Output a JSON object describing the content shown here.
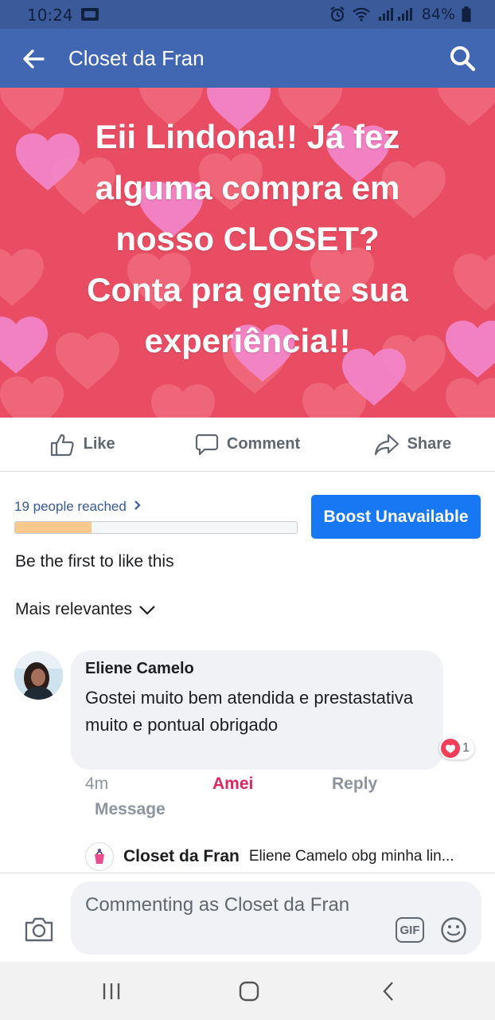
{
  "status_bar": {
    "time": "10:24",
    "battery": "84%"
  },
  "header": {
    "title": "Closet da Fran"
  },
  "post": {
    "text": "Eii Lindona!! Já fez\nalguma compra em\nnosso CLOSET?\nConta pra gente sua\nexperiência!!",
    "background_color": "#e94d63"
  },
  "actions": {
    "like": "Like",
    "comment": "Comment",
    "share": "Share"
  },
  "insights": {
    "reached": "19 people reached",
    "reach_progress": 0.27,
    "boost_label": "Boost Unavailable"
  },
  "likes_text": "Be the first to like this",
  "sort_label": "Mais relevantes",
  "comment": {
    "author": "Eliene Camelo",
    "text": "Gostei muito bem atendida e prestastativa muito e pontual obrigado",
    "reaction_count": "1",
    "time": "4m",
    "reacted_label": "Amei",
    "reply_label": "Reply",
    "message_label": "Message"
  },
  "reply_preview": {
    "author": "Closet da Fran",
    "text": "Eliene Camelo obg minha lin..."
  },
  "composer": {
    "placeholder": "Commenting as Closet da Fran",
    "gif_label": "GIF"
  },
  "colors": {
    "facebook_blue": "#4267b2",
    "boost_blue": "#1877f2",
    "love_red": "#f33e58"
  }
}
